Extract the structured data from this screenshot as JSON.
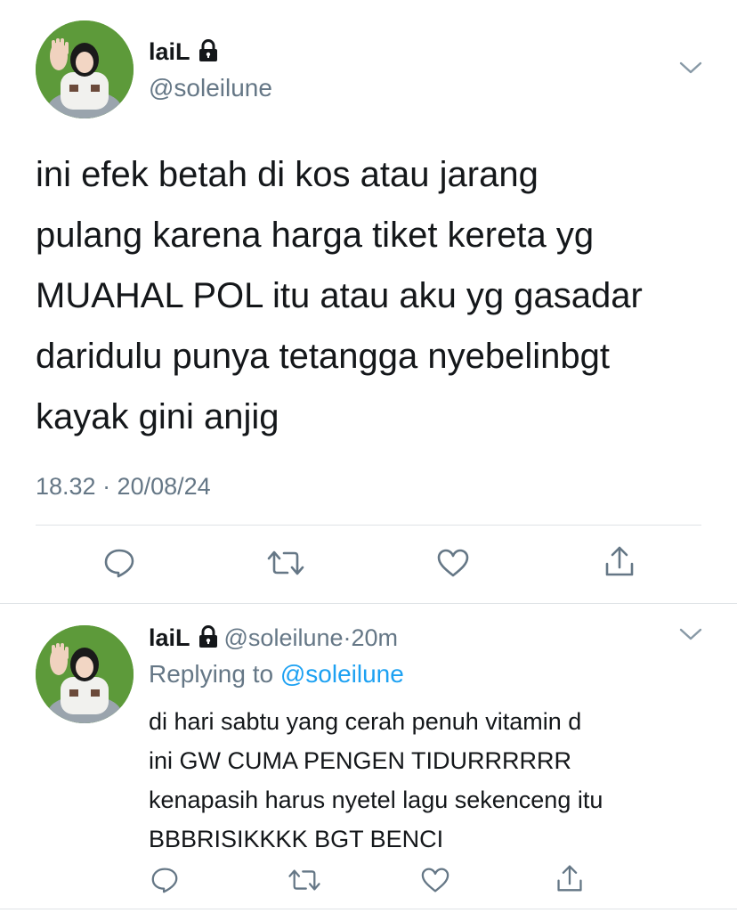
{
  "main_tweet": {
    "display_name": "laiL",
    "handle": "@soleilune",
    "text_lines": [
      "ini efek betah di kos atau jarang",
      "pulang karena harga tiket kereta yg",
      "MUAHAL POL itu atau aku yg gasadar",
      "daridulu punya tetangga nyebelinbgt",
      "kayak gini anjig"
    ],
    "timestamp": "18.32 · 20/08/24",
    "icons": {
      "lock": "lock-icon",
      "menu": "chevron-down-icon",
      "reply": "comment-icon",
      "retweet": "retweet-icon",
      "like": "heart-icon",
      "share": "share-icon"
    }
  },
  "reply_tweet": {
    "display_name": "laiL",
    "handle": "@soleilune",
    "separator": "·",
    "age": "20m",
    "replying_prefix": "Replying to",
    "replying_to": "@soleilune",
    "text_lines": [
      "di hari sabtu yang cerah penuh vitamin d",
      "ini GW CUMA PENGEN TIDURRRRRR",
      "kenapasih harus nyetel lagu sekenceng itu",
      "BBBRISIKKKK BGT BENCI"
    ]
  },
  "colors": {
    "text": "#14171a",
    "secondary": "#657786",
    "link": "#1da1f2",
    "divider": "#dfe3e6",
    "avatar_bg": "#5d9a3a"
  }
}
